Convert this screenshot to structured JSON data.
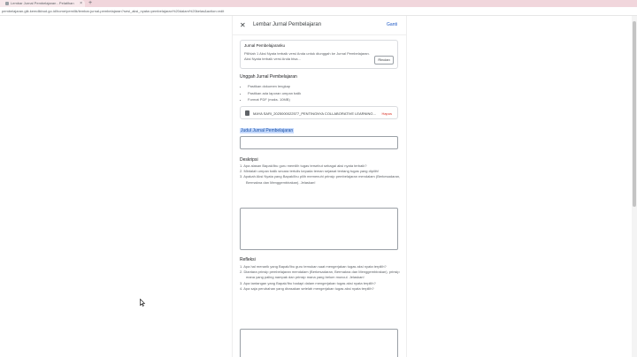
{
  "browser": {
    "tab_title": "Lembar Jurnal Pembelajaran - Pelatihan",
    "new_tab_label": "+",
    "url": "pembelajaran.gtk.kemdikbud.go.id/home/pemilik/lembar-jurnal-pembelajaran?sesi_aksi_nyata=pembelajaran%20dalam%20kelas&action=edit"
  },
  "panel": {
    "title": "Lembar Jurnal Pembelajaran",
    "change_label": "Ganti",
    "info_card": {
      "title": "Jurnal Pembelajaranku",
      "body": "Pilihlah 1 Aksi Nyata terbaik versi Anda untuk diunggah ke Jurnal Pembelajaran. Aksi Nyata terbaik versi Anda bisa...",
      "button_label": "Rincian"
    },
    "upload": {
      "heading": "Unggah Jurnal Pembelajaran",
      "bullets": [
        "Pastikan dokumen lengkap",
        "Pastikan ada laporan umpan balik",
        "Format PDF (maks. 10MB)"
      ],
      "file_name": "MAYA SARI_2025000022577_PENTINGNYA COLLABORATIVE LEARNING.pdf",
      "delete_label": "Hapus"
    },
    "journal_title": {
      "label": "Judul Jurnal Pembelajaran",
      "value": ""
    },
    "description": {
      "heading": "Deskripsi",
      "questions": [
        "1. Apa alasan Bapak/Ibu guru memilih tugas tersebut sebagai aksi nyata terbaik?",
        "2. Mintalah umpan balik secara tertulis kepada teman sejawat tentang tugas yang dipilih!",
        "3. Apakah Aksi Nyata yang Bapak/Ibu pilih memenuhi prinsip pembelajaran mendalam (Berkesadaran, Bermakna dan Menggembirakan). Jelaskan!"
      ],
      "value": ""
    },
    "reflection": {
      "heading": "Refleksi",
      "questions": [
        "1. Apa hal menarik yang Bapak/Ibu guru temukan saat mengerjakan tugas aksi nyata terpilih?",
        "2. Diantara prinsip pembelajaran mendalam (Berkesadaran, Bermakna dan Menggembirakan), prinsip mana yang paling nampak dan prinsip mana yang belum muncul. Jelaskan!",
        "3. Apa tantangan yang Bapak/Ibu hadapi dalam mengerjakan tugas aksi nyata terpilih?",
        "4. Apa saja perubahan yang dirasakan setelah mengerjakan tugas aksi nyata terpilih?"
      ],
      "value": ""
    }
  }
}
